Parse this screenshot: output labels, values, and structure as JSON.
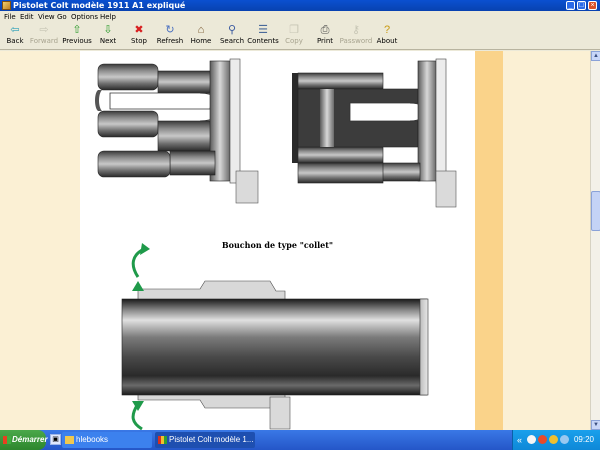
{
  "window": {
    "title": "Pistolet Colt modèle 1911 A1 expliqué",
    "controls": {
      "minimize": "_",
      "maximize": "□",
      "close": "×"
    }
  },
  "menu": {
    "items": [
      {
        "label": "File"
      },
      {
        "label": "Edit"
      },
      {
        "label": "View"
      },
      {
        "label": "Go"
      },
      {
        "label": "Options"
      },
      {
        "label": "Help"
      }
    ]
  },
  "toolbar": {
    "buttons": [
      {
        "label": "Back",
        "icon": "arrow-left-icon",
        "glyph": "⇦",
        "color": "#2a9fb8"
      },
      {
        "label": "Forward",
        "icon": "arrow-right-icon",
        "glyph": "⇨",
        "color": "#9a9a8a"
      },
      {
        "label": "Previous",
        "icon": "arrow-up-icon",
        "glyph": "⇧",
        "color": "#2a9a2a"
      },
      {
        "label": "Next",
        "icon": "arrow-down-icon",
        "glyph": "⇩",
        "color": "#2a9a2a"
      },
      {
        "label": "Stop",
        "icon": "stop-icon",
        "glyph": "✖",
        "color": "#d82020"
      },
      {
        "label": "Refresh",
        "icon": "refresh-icon",
        "glyph": "↻",
        "color": "#4a70c0"
      },
      {
        "label": "Home",
        "icon": "home-icon",
        "glyph": "⌂",
        "color": "#7a5a30"
      },
      {
        "label": "Search",
        "icon": "search-icon",
        "glyph": "⚲",
        "color": "#3a5aa0"
      },
      {
        "label": "Contents",
        "icon": "contents-icon",
        "glyph": "☰",
        "color": "#4a6a9a"
      },
      {
        "label": "Copy",
        "icon": "copy-icon",
        "glyph": "❐",
        "color": "#9a9a8a"
      },
      {
        "label": "Print",
        "icon": "print-icon",
        "glyph": "⎙",
        "color": "#4a4a4a"
      },
      {
        "label": "Password",
        "icon": "key-icon",
        "glyph": "⚷",
        "color": "#9a9a8a"
      },
      {
        "label": "About",
        "icon": "help-icon",
        "glyph": "?",
        "color": "#c89a10"
      }
    ]
  },
  "content": {
    "caption": "Bouchon de type \"collet\"",
    "colors": {
      "page_bg": "#ffffff",
      "margin_bg": "#fbf0d4",
      "stripe": "#fad38a",
      "arrow": "#1f9a4a"
    }
  },
  "taskbar": {
    "start_label": "Démarrer",
    "tasks": [
      {
        "label": "hlebooks",
        "icon": "folder-icon"
      },
      {
        "label": "Pistolet Colt modèle 1...",
        "icon": "book-icon"
      }
    ],
    "clock": "09:20",
    "tray_chevron": "«"
  }
}
